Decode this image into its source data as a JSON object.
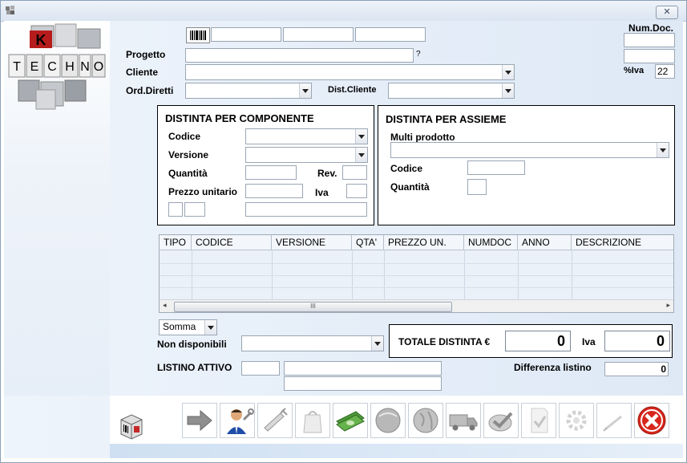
{
  "window": {
    "close_glyph": "✕"
  },
  "header": {
    "num_doc_label": "Num.Doc.",
    "iva_label": "%Iva",
    "iva_value": "22",
    "progetto_label": "Progetto",
    "progetto_help": "?",
    "cliente_label": "Cliente",
    "ord_diretti_label": "Ord.Diretti",
    "dist_cliente_label": "Dist.Cliente"
  },
  "logo": {
    "letters": [
      "K",
      "T",
      "E",
      "C",
      "H",
      "N",
      "O"
    ]
  },
  "componente": {
    "title": "DISTINTA PER COMPONENTE",
    "codice_label": "Codice",
    "versione_label": "Versione",
    "quantita_label": "Quantità",
    "rev_label": "Rev.",
    "prezzo_label": "Prezzo unitario",
    "iva_label": "Iva"
  },
  "assieme": {
    "title": "DISTINTA PER ASSIEME",
    "multi_label": "Multi prodotto",
    "codice_label": "Codice",
    "quantita_label": "Quantità"
  },
  "grid": {
    "columns": [
      "TIPO",
      "CODICE",
      "VERSIONE",
      "QTA'",
      "PREZZO UN.",
      "NUMDOC",
      "ANNO",
      "DESCRIZIONE"
    ],
    "thumb_glyph": "III",
    "left_arrow": "◂",
    "right_arrow": "▸"
  },
  "bottom": {
    "somma_value": "Somma",
    "non_disponibili_label": "Non disponibili",
    "listino_label": "LISTINO ATTIVO",
    "totale_label": "TOTALE DISTINTA €",
    "totale_value": "0",
    "iva_label": "Iva",
    "iva_value": "0",
    "differenza_label": "Differenza listino",
    "differenza_value": "0"
  },
  "toolbar": {
    "icons": [
      "arrow-right-icon",
      "user-tools-icon",
      "syringe-icon",
      "bag-icon",
      "money-icon",
      "sphere-icon",
      "globe-icon",
      "truck-icon",
      "check-seal-icon",
      "check-doc-icon",
      "gear-icon",
      "pen-icon",
      "close-x-icon"
    ]
  },
  "colors": {
    "accent": "#1f4ea8",
    "close_red": "#d8261c",
    "panel_bg": "#e6eef8"
  }
}
